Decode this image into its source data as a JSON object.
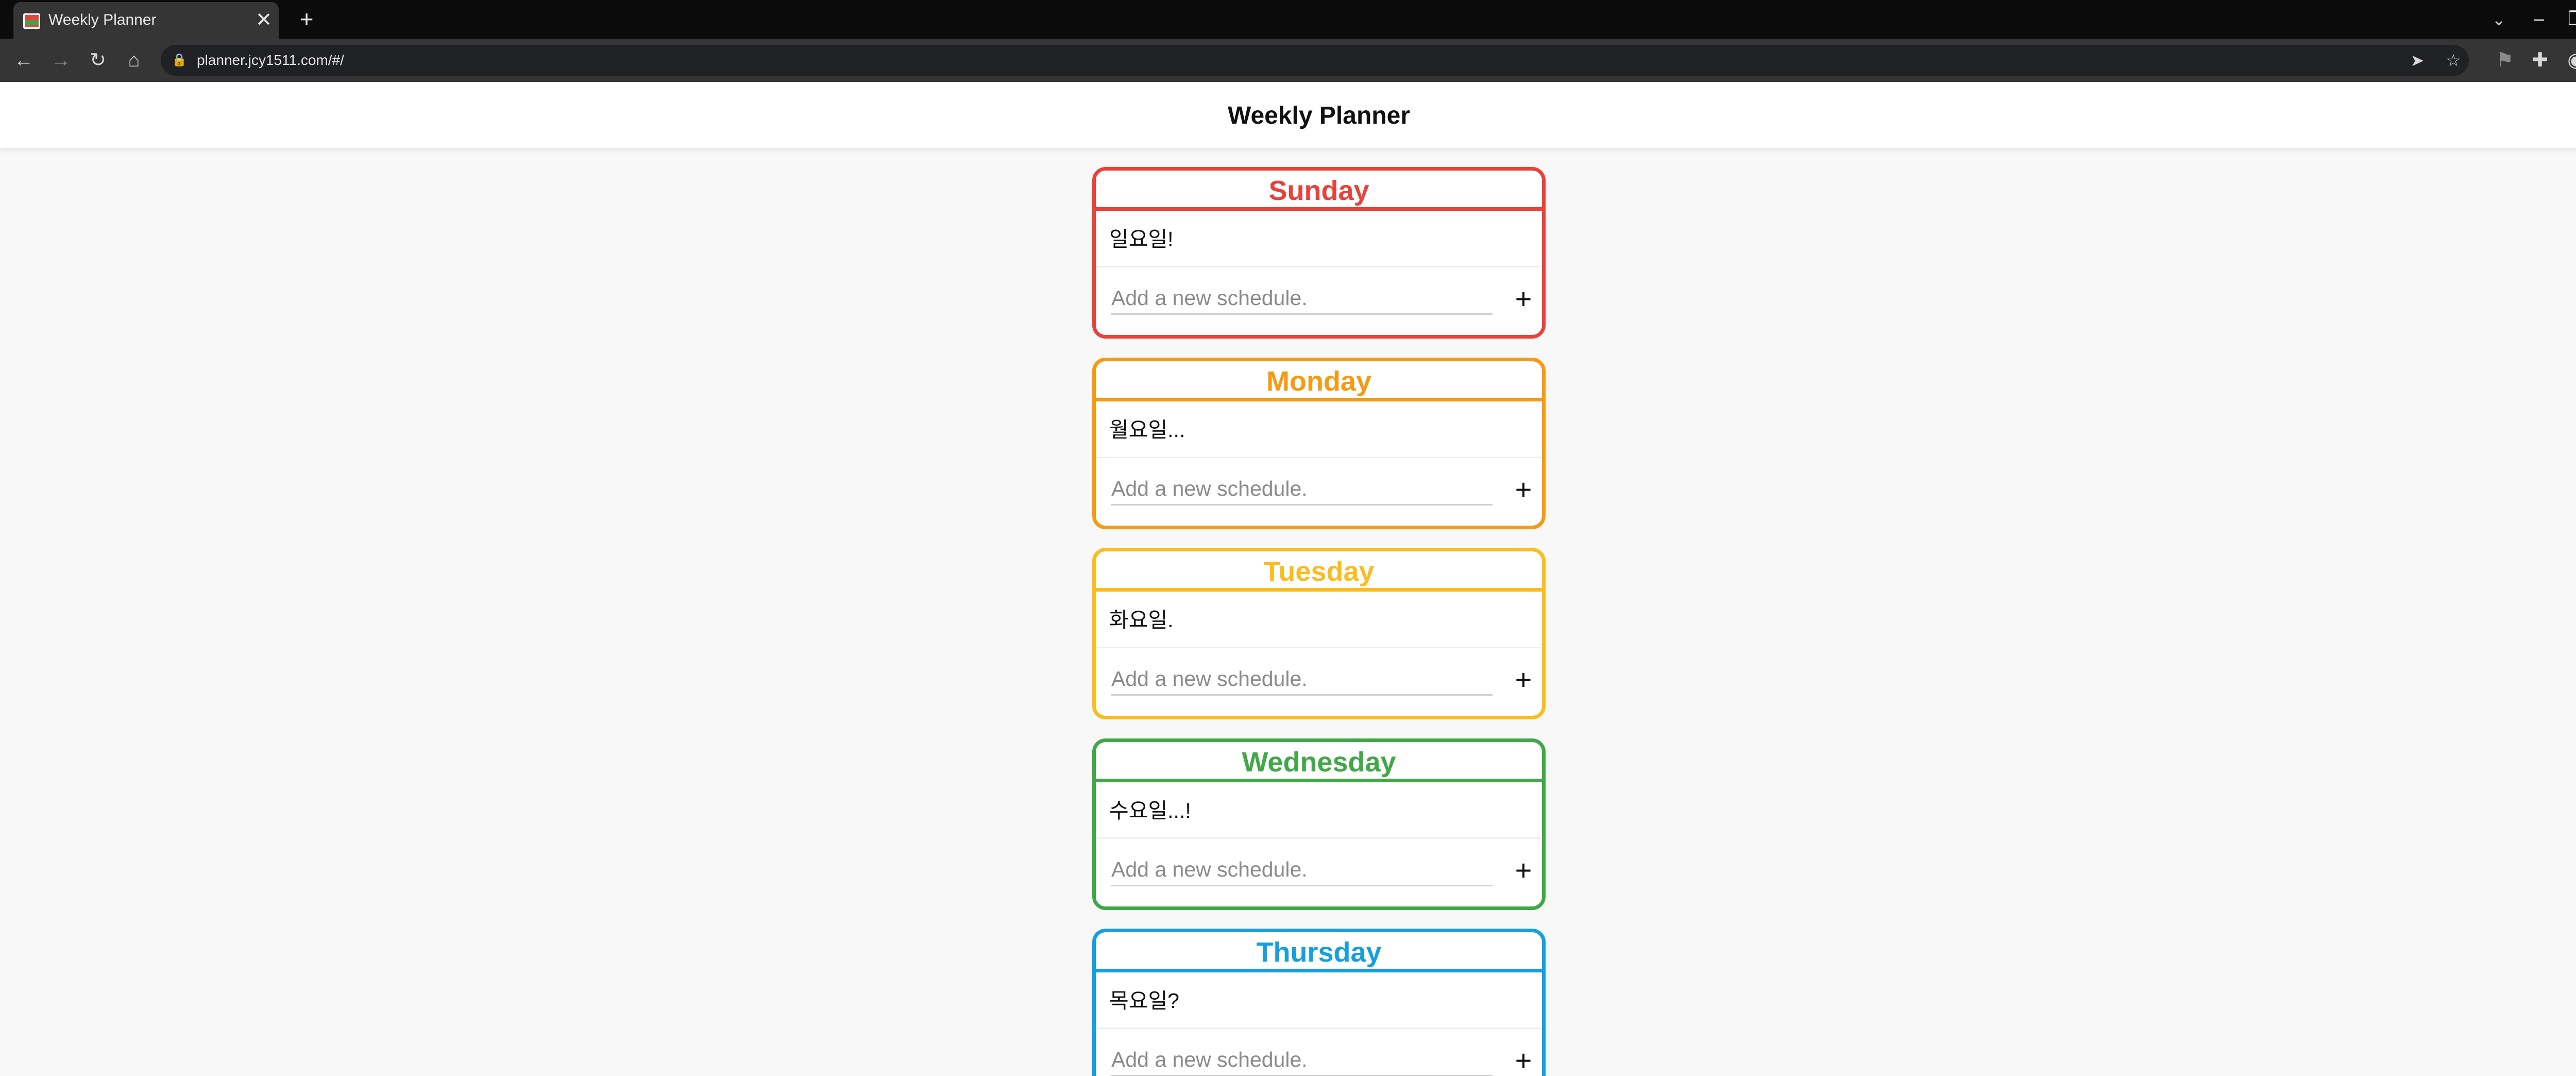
{
  "browser": {
    "tab_title": "Weekly Planner",
    "tab_close_glyph": "✕",
    "new_tab_glyph": "+",
    "url": "planner.jcy1511.com/#/",
    "icons": [
      "back-arrow-icon",
      "forward-arrow-icon",
      "reload-icon",
      "home-icon",
      "lock-icon",
      "send-icon",
      "star-icon",
      "bookmark-icon",
      "extensions-icon",
      "profile-avatar-icon",
      "menu-kebab-icon",
      "tab-search-icon",
      "minimize-icon",
      "restore-icon",
      "window-close-icon"
    ]
  },
  "page": {
    "title": "Weekly Planner"
  },
  "days": [
    {
      "name": "Sunday",
      "color": "#e8423a",
      "schedules": [
        "일요일!"
      ],
      "placeholder": "Add a new schedule.",
      "add_label": "+"
    },
    {
      "name": "Monday",
      "color": "#f59a12",
      "schedules": [
        "월요일..."
      ],
      "placeholder": "Add a new schedule.",
      "add_label": "+"
    },
    {
      "name": "Tuesday",
      "color": "#f9bd20",
      "schedules": [
        "화요일."
      ],
      "placeholder": "Add a new schedule.",
      "add_label": "+"
    },
    {
      "name": "Wednesday",
      "color": "#41a847",
      "schedules": [
        "수요일...!"
      ],
      "placeholder": "Add a new schedule.",
      "add_label": "+"
    },
    {
      "name": "Thursday",
      "color": "#14a0e0",
      "schedules": [
        "목요일?"
      ],
      "placeholder": "Add a new schedule.",
      "add_label": "+"
    }
  ]
}
